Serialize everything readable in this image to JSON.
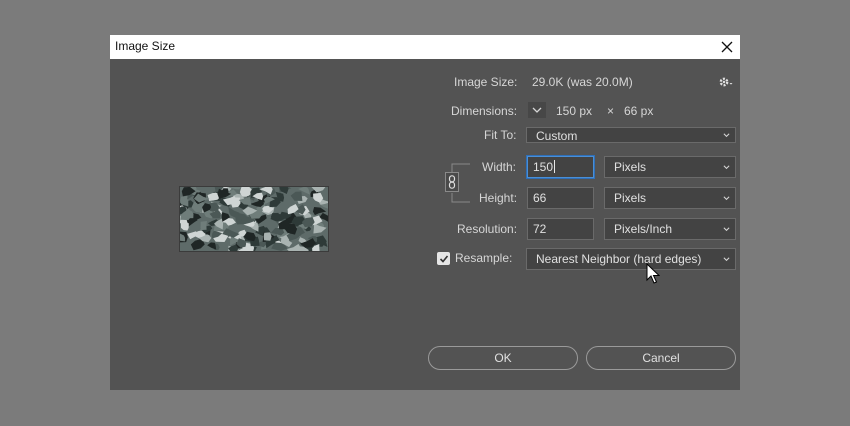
{
  "dialog": {
    "title": "Image Size"
  },
  "info": {
    "image_size_label": "Image Size:",
    "image_size_value": "29.0K (was 20.0M)",
    "dimensions_label": "Dimensions:",
    "dim_width": "150 px",
    "dim_times": "×",
    "dim_height": "66 px"
  },
  "fit_to": {
    "label": "Fit To:",
    "value": "Custom"
  },
  "width": {
    "label": "Width:",
    "value": "150",
    "unit": "Pixels"
  },
  "height": {
    "label": "Height:",
    "value": "66",
    "unit": "Pixels"
  },
  "resolution": {
    "label": "Resolution:",
    "value": "72",
    "unit": "Pixels/Inch"
  },
  "resample": {
    "label": "Resample:",
    "checked": true,
    "value": "Nearest Neighbor (hard edges)"
  },
  "buttons": {
    "ok": "OK",
    "cancel": "Cancel"
  },
  "icons": {
    "close": "close-icon",
    "gear": "gear-icon",
    "chevron": "chevron-down-icon",
    "link": "chain-link-icon",
    "check": "checkmark-icon",
    "cursor": "mouse-cursor-icon"
  },
  "colors": {
    "dialog_bg": "#535353",
    "backdrop": "#7b7b7b",
    "field_bg": "#434343",
    "focus": "#4a8fd6"
  }
}
